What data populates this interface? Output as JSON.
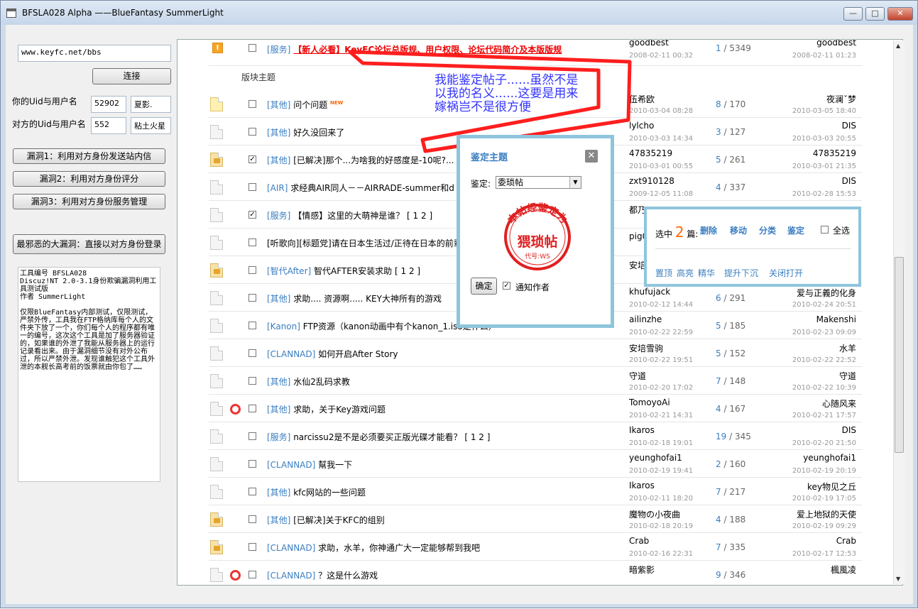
{
  "window": {
    "title": "BFSLA028 Alpha ——BlueFantasy SummerLight",
    "min": "—",
    "max": "□",
    "close": "✕"
  },
  "sidebar": {
    "url": "www.keyfc.net/bbs",
    "connect": "连接",
    "your_label": "你的Uid与用户名",
    "your_uid": "52902",
    "your_name": "夏影.",
    "their_label": "对方的Uid与用户名",
    "their_uid": "552",
    "their_name": "粘土火星",
    "vuln1": "漏洞1：利用对方身份发送站内信",
    "vuln2": "漏洞2：利用对方身份评分",
    "vuln3": "漏洞3：利用对方身份服务管理",
    "worst": "最邪恶的大漏洞：直接以对方身份登录",
    "memo": "工具编号 BFSLA028\nDiscuz!NT 2.0-3.1身份欺骗漏洞利用工具测试版\n作者 SummerLight\n\n仅限BlueFantasy内部测试，仅限测试，严禁外传，工具我在FTP格纳库每个人的文件夹下放了一个，你们每个人的程序都有唯一的编号，这次这个工具是加了服务器验证的，如果谁的外泄了我能从服务器上的运行记录看出来。由于漏洞细节没有对外公布过，所以严禁外泄。发现谁触犯这个工具外泄的本舰长高考前的饭票就由你包了……"
  },
  "forum": {
    "top": {
      "icon": "I",
      "tag": "[服务]",
      "title": "【新人必看】KeyFC论坛总版规、用户权限、论坛代码简介及本版版规",
      "author": "goodbest",
      "date": "2008-02-11 00:32",
      "replies": "1",
      "views": "5349",
      "last": "goodbest",
      "last_date": "2008-02-11 01:23"
    },
    "section": "版块主题",
    "threads": [
      {
        "icon": "new",
        "hot": false,
        "checked": false,
        "tag": "[其他]",
        "title": "问个问题",
        "badge": "NEW",
        "pages": "",
        "author": "伍希欧",
        "date": "2010-03-04 08:28",
        "replies": "8",
        "views": "170",
        "last": "夜澜ˇ梦",
        "last_date": "2010-03-05 18:40"
      },
      {
        "icon": "normal",
        "hot": false,
        "checked": false,
        "tag": "[其他]",
        "title": "好久没回来了",
        "badge": "",
        "pages": "",
        "author": "lylcho",
        "date": "2010-03-03 14:34",
        "replies": "3",
        "views": "127",
        "last": "DIS",
        "last_date": "2010-03-03 20:55"
      },
      {
        "icon": "lock",
        "hot": false,
        "checked": true,
        "tag": "[其他]",
        "title": "[已解决]那个...为啥我的好感度是-10呢?...",
        "badge": "",
        "pages": "",
        "author": "47835219",
        "date": "2010-03-01 00:55",
        "replies": "5",
        "views": "261",
        "last": "47835219",
        "last_date": "2010-03-01 21:35"
      },
      {
        "icon": "normal",
        "hot": false,
        "checked": false,
        "tag": "[AIR]",
        "title": "求经典AIR同人－－AIRRADE-summer和d",
        "badge": "",
        "pages": "",
        "author": "zxt910128",
        "date": "2009-12-05 11:08",
        "replies": "4",
        "views": "337",
        "last": "DIS",
        "last_date": "2010-02-28 15:53"
      },
      {
        "icon": "normal",
        "hot": false,
        "checked": true,
        "tag": "[服务]",
        "title": "【情感】这里的大萌神是谁？",
        "badge": "",
        "pages": "[ 1 2 ]",
        "author": "都乃",
        "date": "",
        "replies": "",
        "views": "",
        "last": "",
        "last_date": ""
      },
      {
        "icon": "normal",
        "hot": false,
        "checked": false,
        "tag": "",
        "title": "[听歌向][标题党]请在日本生活过/正待在日本的前辈",
        "badge": "",
        "pages": "",
        "author": "pig0",
        "date": "",
        "replies": "",
        "views": "",
        "last": "",
        "last_date": ""
      },
      {
        "icon": "lock",
        "hot": false,
        "checked": false,
        "tag": "[智代After]",
        "title": "智代AFTER安装求助",
        "badge": "",
        "pages": "[ 1 2 ]",
        "author": "安培",
        "date": "",
        "replies": "",
        "views": "",
        "last": "",
        "last_date": ""
      },
      {
        "icon": "normal",
        "hot": false,
        "checked": false,
        "tag": "[其他]",
        "title": "求助.... 资源啊..... KEY大神所有的游戏",
        "badge": "",
        "pages": "",
        "author": "khufujack",
        "date": "2010-02-12 14:44",
        "replies": "6",
        "views": "291",
        "last": "爱与正義的化身",
        "last_date": "2010-02-24 20:51"
      },
      {
        "icon": "normal",
        "hot": false,
        "checked": false,
        "tag": "[Kanon]",
        "title": "FTP资源（kanon动画中有个kanon_1.iso是什么）",
        "badge": "",
        "pages": "",
        "author": "ailinzhe",
        "date": "2010-02-22 22:59",
        "replies": "5",
        "views": "185",
        "last": "Makenshi",
        "last_date": "2010-02-23 09:09"
      },
      {
        "icon": "normal",
        "hot": false,
        "checked": false,
        "tag": "[CLANNAD]",
        "title": "如何开启After Story",
        "badge": "",
        "pages": "",
        "author": "安培雪驹",
        "date": "2010-02-22 19:51",
        "replies": "5",
        "views": "152",
        "last": "水羊",
        "last_date": "2010-02-22 22:52"
      },
      {
        "icon": "normal",
        "hot": false,
        "checked": false,
        "tag": "[其他]",
        "title": "水仙2乱码求教",
        "badge": "",
        "pages": "",
        "author": "守道",
        "date": "2010-02-20 17:02",
        "replies": "7",
        "views": "148",
        "last": "守道",
        "last_date": "2010-02-22 10:39"
      },
      {
        "icon": "normal",
        "hot": true,
        "checked": false,
        "tag": "[其他]",
        "title": "求助，关于Key游戏问题",
        "badge": "",
        "pages": "",
        "author": "TomoyoAi",
        "date": "2010-02-21 14:31",
        "replies": "4",
        "views": "167",
        "last": "心随风来",
        "last_date": "2010-02-21 17:57"
      },
      {
        "icon": "normal",
        "hot": false,
        "checked": false,
        "tag": "[服务]",
        "title": "narcissu2是不是必须要买正版光碟才能看？",
        "badge": "",
        "pages": "[ 1 2 ]",
        "author": "Ikaros",
        "date": "2010-02-18 19:01",
        "replies": "19",
        "views": "345",
        "last": "DIS",
        "last_date": "2010-02-20 21:50"
      },
      {
        "icon": "normal",
        "hot": false,
        "checked": false,
        "tag": "[CLANNAD]",
        "title": "幫我一下",
        "badge": "",
        "pages": "",
        "author": "yeunghofai1",
        "date": "2010-02-19 19:41",
        "replies": "2",
        "views": "160",
        "last": "yeunghofai1",
        "last_date": "2010-02-19 20:19"
      },
      {
        "icon": "normal",
        "hot": false,
        "checked": false,
        "tag": "[其他]",
        "title": "kfc网站的一些问题",
        "badge": "",
        "pages": "",
        "author": "Ikaros",
        "date": "2010-02-11 18:20",
        "replies": "7",
        "views": "217",
        "last": "key物见之丘",
        "last_date": "2010-02-19 17:05"
      },
      {
        "icon": "lock",
        "hot": false,
        "checked": false,
        "tag": "[其他]",
        "title": "[已解决]关于KFC的组别",
        "badge": "",
        "pages": "",
        "author": "魔物の小夜曲",
        "date": "2010-02-18 20:19",
        "replies": "4",
        "views": "188",
        "last": "爱上地狱的天使",
        "last_date": "2010-02-19 09:29"
      },
      {
        "icon": "lock",
        "hot": false,
        "checked": false,
        "tag": "[CLANNAD]",
        "title": "求助，水羊，你神通广大一定能够帮到我吧",
        "badge": "",
        "pages": "",
        "author": "Crab",
        "date": "2010-02-16 22:31",
        "replies": "7",
        "views": "335",
        "last": "Crab",
        "last_date": "2010-02-17 12:53"
      },
      {
        "icon": "normal",
        "hot": true,
        "checked": false,
        "tag": "[CLANNAD]",
        "title": "？这是什么游戏",
        "badge": "",
        "pages": "",
        "author": "暗紫影",
        "date": "",
        "replies": "9",
        "views": "346",
        "last": "楓風凌",
        "last_date": ""
      }
    ]
  },
  "annotation": {
    "line1": "我能鉴定帖子......虽然不是",
    "line2": "以我的名义......这要是用来",
    "line3": "嫁祸岂不是很方便"
  },
  "dialog": {
    "title": "鉴定主题",
    "close": "✕",
    "label": "鉴定:",
    "value": "委琐帖",
    "seal_top": "本帖经鉴定为",
    "seal_main": "猥琐帖",
    "seal_code": "代号:WS",
    "ok": "确定",
    "notify": "通知作者"
  },
  "panel": {
    "selected_prefix": "选中",
    "count": "2",
    "selected_suffix": "篇:",
    "delete": "删除",
    "move": "移动",
    "classify": "分类",
    "identify": "鉴定",
    "select_all": "全选",
    "pin": "置顶",
    "highlight": "高亮",
    "digest": "精华",
    "bump": "提升下沉",
    "close": "关闭打开"
  },
  "colors": {
    "accent": "#3a7ec0",
    "annotation": "#3333ff",
    "arrow": "#ff1e1e",
    "seal": "#e02020"
  }
}
